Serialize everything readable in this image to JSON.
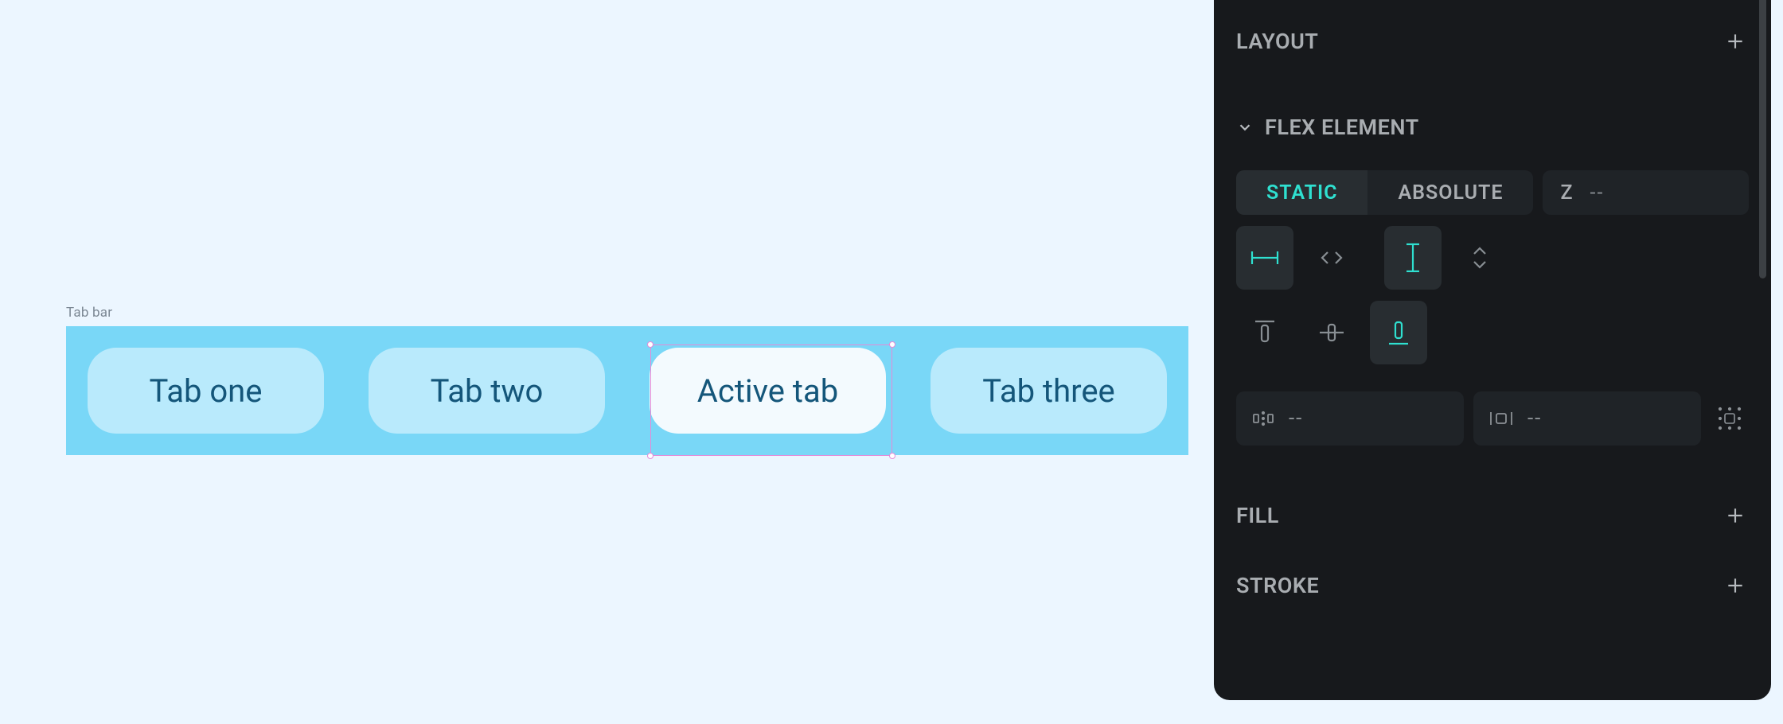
{
  "canvas": {
    "frame_label": "Tab bar",
    "tabs": [
      {
        "label": "Tab one",
        "active": false
      },
      {
        "label": "Tab two",
        "active": false
      },
      {
        "label": "Active tab",
        "active": true
      },
      {
        "label": "Tab three",
        "active": false
      }
    ]
  },
  "inspector": {
    "sections": {
      "layout": "LAYOUT",
      "flex_element": "FLEX ELEMENT",
      "fill": "FILL",
      "stroke": "STROKE"
    },
    "position_mode": {
      "options": [
        "STATIC",
        "ABSOLUTE"
      ],
      "selected": "STATIC"
    },
    "z_index": {
      "label": "Z",
      "value": "--"
    },
    "width_mode_selected": "fixed",
    "height_mode_selected": "hug",
    "align_selected": "bottom",
    "gap_value": "--",
    "padding_value": "--"
  }
}
